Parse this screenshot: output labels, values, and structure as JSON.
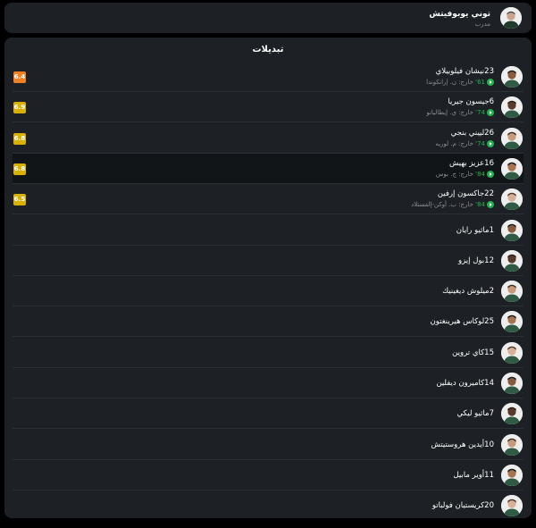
{
  "coach": {
    "name": "توني يوبوفيتش",
    "role": "مدرب"
  },
  "substitutes": {
    "title": "تبديلات",
    "players": [
      {
        "number": "23",
        "name": "نيشان فيلوبيلاي",
        "minute": "61'",
        "sub_text": "خارج: ن. إرانكوندا",
        "rating": "6.4",
        "rating_color": "#f08022"
      },
      {
        "number": "6",
        "name": "جيسون جيريا",
        "minute": "74'",
        "sub_text": "خارج: ي. إيطاليانو",
        "rating": "6.9",
        "rating_color": "#d9af00"
      },
      {
        "number": "26",
        "name": "لييني بنجي",
        "minute": "74'",
        "sub_text": "خارج: م. لوريه",
        "rating": "6.8",
        "rating_color": "#d9af00"
      },
      {
        "number": "16",
        "name": "عزيز بهيش",
        "minute": "84'",
        "sub_text": "خارج: ج. بوس",
        "rating": "6.8",
        "rating_color": "#d9af00",
        "highlight": true
      },
      {
        "number": "22",
        "name": "جاكسون إرفين",
        "minute": "84'",
        "sub_text": "خارج: ب. أوكن-إلفستلاد",
        "rating": "6.5",
        "rating_color": "#d9af00"
      },
      {
        "number": "1",
        "name": "ماثيو رايان"
      },
      {
        "number": "12",
        "name": "بول إيزو"
      },
      {
        "number": "2",
        "name": "ميلوش ديغينيك"
      },
      {
        "number": "25",
        "name": "لوكاس هيرينغتون"
      },
      {
        "number": "15",
        "name": "كاي تروين"
      },
      {
        "number": "14",
        "name": "كاميرون ديفلين"
      },
      {
        "number": "7",
        "name": "ماثيو ليكي"
      },
      {
        "number": "10",
        "name": "أيدين هروستيتش"
      },
      {
        "number": "11",
        "name": "أوير مابيل"
      },
      {
        "number": "20",
        "name": "كريستيان فولباتو"
      }
    ]
  }
}
